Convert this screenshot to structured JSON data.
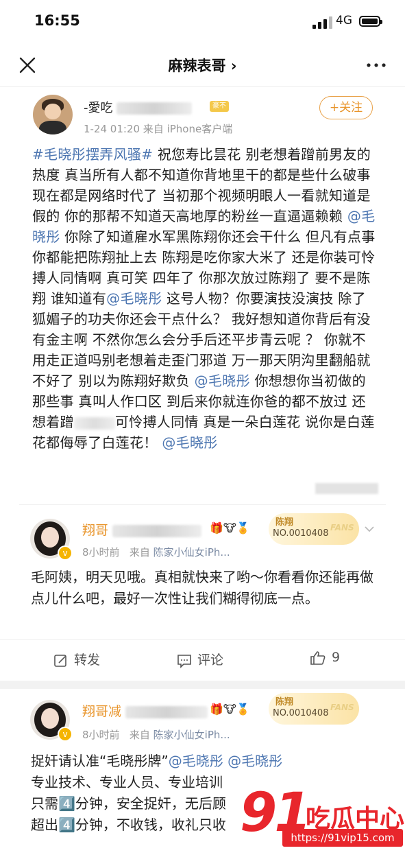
{
  "status_bar": {
    "time": "16:55",
    "network": "4G"
  },
  "nav": {
    "title": "麻辣表哥 ›"
  },
  "post": {
    "username_prefix": "-愛吃",
    "vip_label": "豪不",
    "meta": "1-24 01:20  来自 iPhone客户端",
    "follow_label": "+关注",
    "segments": [
      {
        "t": "#毛晓彤摆弄风骚#",
        "link": true
      },
      {
        "t": " 祝您寿比昙花 别老想着蹭前男友的热度 真当所有人都不知道你背地里干的都是些什么破事 现在都是网络时代了 当初那个视频明眼人一看就知道是假的 你的那帮不知道天高地厚的粉丝一直逼逼赖赖 ",
        "link": false
      },
      {
        "t": "@毛晓彤",
        "link": true
      },
      {
        "t": " 你除了知道雇水军黑陈翔你还会干什么 但凡有点事你都能把陈翔扯上去 陈翔是吃你家大米了 还是你装可怜搏人同情啊 真可笑 四年了 你那次放过陈翔了 要不是陈翔 谁知道有",
        "link": false
      },
      {
        "t": "@毛晓彤",
        "link": true
      },
      {
        "t": " 这号人物？你要演技没演技 除了狐媚子的功夫你还会干点什么？ 我好想知道你背后有没有金主啊 不然你怎么会分手后还平步青云呢 ？ 你就不用走正道吗别老想着走歪门邪道 万一那天阴沟里翻船就不好了 别以为陈翔好欺负 ",
        "link": false
      },
      {
        "t": "@毛晓彤",
        "link": true
      },
      {
        "t": " 你想想你当初做的那些事 真叫人作口区  到后来你就连你爸的都不放过 还想着蹭",
        "link": false
      },
      {
        "t": "",
        "link": false,
        "blur": true
      },
      {
        "t": "可怜搏人同情 真是一朵白莲花 说你是白莲花都侮辱了白莲花！ ",
        "link": false
      },
      {
        "t": "@毛晓彤",
        "link": true
      }
    ]
  },
  "comments": [
    {
      "name_prefix": "翔哥",
      "fans_name": "陈翔",
      "fans_no": "NO.0010408",
      "fans_word": "FANS",
      "time": "8小时前",
      "from": "来自",
      "source": "陈家小仙女iPh...",
      "text": "毛阿姨，明天见哦。真相就快来了哟～你看看你还能再做点儿什么吧，最好一次性让我们糊得彻底一点。",
      "actions": {
        "repost": "转发",
        "comment": "评论",
        "like": "9"
      }
    },
    {
      "name_prefix": "翔哥减",
      "fans_name": "陈翔",
      "fans_no": "NO.0010408",
      "fans_word": "FANS",
      "time": "8小时前",
      "from": "来自",
      "source": "陈家小仙女iPh...",
      "lines": [
        "捉奸请认准“毛晓彤牌”",
        "专业技术、专业人员、专业培训",
        "只需4️⃣分钟，安全捉奸，无后顾",
        "超出4️⃣分钟，不收钱，收礼只收"
      ],
      "links": [
        "@毛晓彤",
        "@毛晓彤"
      ]
    }
  ],
  "watermark": {
    "brand_num": "91",
    "brand_text": "吃瓜中心",
    "url": "https://91vip15.com"
  },
  "colors": {
    "link": "#4d76b1",
    "orange": "#e8942a",
    "watermark": "#e8262c"
  }
}
